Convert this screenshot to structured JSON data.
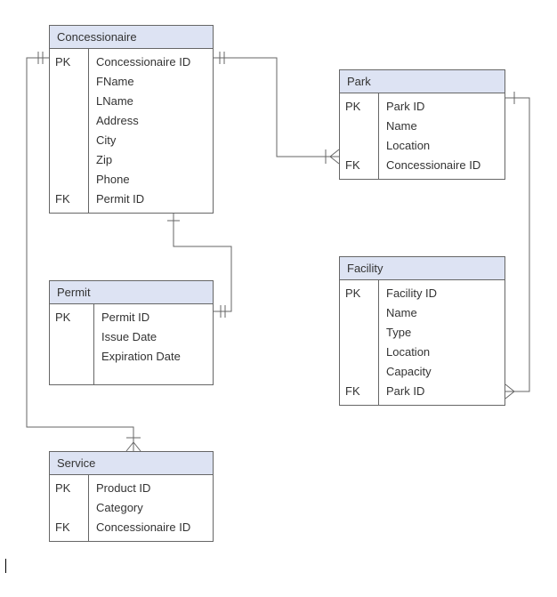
{
  "entities": {
    "concessionaire": {
      "title": "Concessionaire",
      "keys": [
        "PK",
        "",
        "",
        "",
        "",
        "",
        "",
        "FK"
      ],
      "attrs": [
        "Concessionaire ID",
        "FName",
        "LName",
        "Address",
        "City",
        "Zip",
        "Phone",
        "Permit ID"
      ]
    },
    "park": {
      "title": "Park",
      "keys": [
        "PK",
        "",
        "",
        "FK"
      ],
      "attrs": [
        "Park ID",
        "Name",
        "Location",
        "Concessionaire ID"
      ]
    },
    "permit": {
      "title": "Permit",
      "keys": [
        "PK",
        "",
        ""
      ],
      "attrs": [
        "Permit ID",
        "Issue Date",
        "Expiration Date"
      ]
    },
    "facility": {
      "title": "Facility",
      "keys": [
        "PK",
        "",
        "",
        "",
        "",
        "FK"
      ],
      "attrs": [
        "Facility ID",
        "Name",
        "Type",
        "Location",
        "Capacity",
        "Park ID"
      ]
    },
    "service": {
      "title": "Service",
      "keys": [
        "PK",
        "",
        "FK"
      ],
      "attrs": [
        "Product ID",
        "Category",
        "Concessionaire ID"
      ]
    }
  }
}
